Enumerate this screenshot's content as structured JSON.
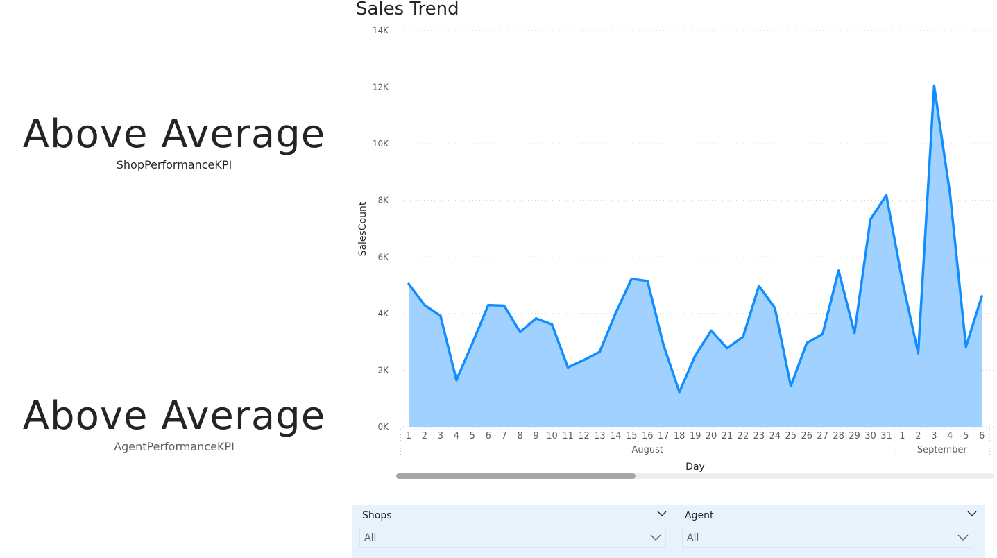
{
  "kpis": {
    "shop": {
      "value": "Above Average",
      "label": "ShopPerformanceKPI"
    },
    "agent": {
      "value": "Above Average",
      "label": "AgentPerformanceKPI"
    }
  },
  "chart_title": "Sales Trend",
  "chart_data": {
    "type": "area",
    "title": "Sales Trend",
    "xlabel": "Day",
    "ylabel": "SalesCount",
    "ylim": [
      0,
      14000
    ],
    "y_ticks": [
      0,
      2000,
      4000,
      6000,
      8000,
      10000,
      12000,
      14000
    ],
    "y_tick_labels": [
      "0K",
      "2K",
      "4K",
      "6K",
      "8K",
      "10K",
      "12K",
      "14K"
    ],
    "grid": true,
    "colors": {
      "line": "#118dff",
      "fill": "#a0d1ff",
      "grid": "#c8c6c4",
      "axis_text": "#605e5c"
    },
    "groups": [
      {
        "label": "August",
        "days": [
          "1",
          "2",
          "3",
          "4",
          "5",
          "6",
          "7",
          "8",
          "9",
          "10",
          "11",
          "12",
          "13",
          "14",
          "15",
          "16",
          "17",
          "18",
          "19",
          "20",
          "21",
          "22",
          "23",
          "24",
          "25",
          "26",
          "27",
          "28",
          "29",
          "30",
          "31"
        ]
      },
      {
        "label": "September",
        "days": [
          "1",
          "2",
          "3",
          "4",
          "5",
          "6"
        ]
      }
    ],
    "series": [
      {
        "values": [
          5050,
          4300,
          3920,
          1650,
          2950,
          4300,
          4280,
          3350,
          3830,
          3620,
          2100,
          2360,
          2650,
          4020,
          5230,
          5150,
          2900,
          1230,
          2520,
          3400,
          2780,
          3180,
          4980,
          4200,
          1440,
          2960,
          3280,
          5520,
          3320,
          7330,
          8180,
          5170,
          2600,
          12050,
          8230,
          2830,
          4620
        ]
      }
    ]
  },
  "slicers": {
    "shops": {
      "title": "Shops",
      "value": "All"
    },
    "agent": {
      "title": "Agent",
      "value": "All"
    }
  },
  "icons": {
    "collapse": "chevron-down-icon",
    "dropdown": "chevron-down-icon"
  }
}
